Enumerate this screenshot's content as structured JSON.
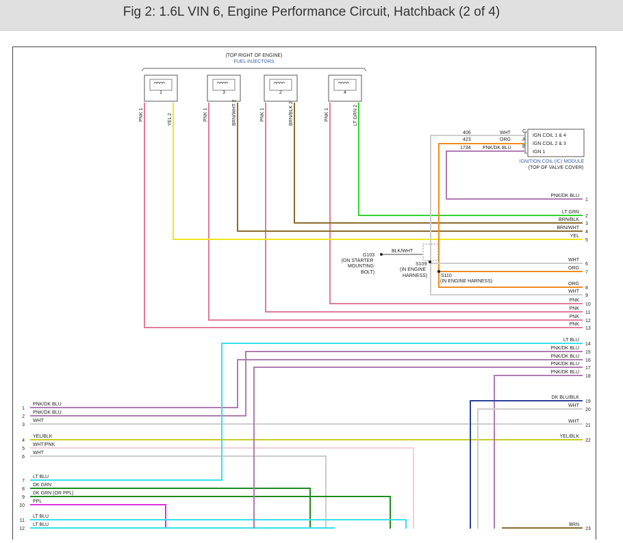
{
  "title": "Fig 2: 1.6L VIN 6, Engine Performance Circuit, Hatchback (2 of 4)",
  "injectors": {
    "location": "(TOP RIGHT OF ENGINE)",
    "name": "FUEL INJECTORS",
    "items": [
      {
        "num": "1",
        "pin1": "PNK 1",
        "pin2": "YEL 2"
      },
      {
        "num": "3",
        "pin1": "PNK 1",
        "pin2": "BRN/WHT 2"
      },
      {
        "num": "2",
        "pin1": "PNK 1",
        "pin2": "BRN/BLK 2"
      },
      {
        "num": "4",
        "pin1": "PNK 1",
        "pin2": "LT GRN 2"
      }
    ]
  },
  "ic_module": {
    "name": "IGNITION COIL (IC) MODULE",
    "location": "(TOP OF VALVE COVER)",
    "pins": [
      {
        "circuit": "406",
        "color": "WHT",
        "letter": "C",
        "label": "IGN COIL 1 & 4"
      },
      {
        "circuit": "423",
        "color": "ORG",
        "letter": "A",
        "label": "IGN COIL 2 & 3"
      },
      {
        "circuit": "1734",
        "color": "PNK/DK BLU",
        "letter": "B",
        "label": "IGN 1"
      }
    ]
  },
  "ground": {
    "id": "G103",
    "wire": "BLK/WHT",
    "location": "(ON STARTER MOUNTING BOLT)",
    "loc1": "(ON STARTER",
    "loc2": "MOUNTING",
    "loc3": "BOLT)"
  },
  "splices": [
    {
      "id": "S109",
      "loc1": "(IN ENGINE",
      "loc2": "HARNESS)"
    },
    {
      "id": "S110",
      "loc1": "(IN ENGINE HARNESS)"
    }
  ],
  "right_wires": [
    {
      "label": "PNK/DK BLU",
      "num": "1"
    },
    {
      "label": "LT GRN",
      "num": "2"
    },
    {
      "label": "BRN/BLK",
      "num": "3"
    },
    {
      "label": "BRN/WHT",
      "num": "4"
    },
    {
      "label": "YEL",
      "num": "5"
    },
    {
      "label": "WHT",
      "num": "6"
    },
    {
      "label": "ORG",
      "num": "7"
    },
    {
      "label": "ORG",
      "num": "8"
    },
    {
      "label": "WHT",
      "num": "9"
    },
    {
      "label": "PNK",
      "num": "10"
    },
    {
      "label": "PNK",
      "num": "11"
    },
    {
      "label": "PNK",
      "num": "12"
    },
    {
      "label": "PNK",
      "num": "13"
    },
    {
      "label": "LT BLU",
      "num": "14"
    },
    {
      "label": "PNK/DK BLU",
      "num": "15"
    },
    {
      "label": "PNK/DK BLU",
      "num": "16"
    },
    {
      "label": "PNK/DK BLU",
      "num": "17"
    },
    {
      "label": "PNK/DK BLU",
      "num": "18"
    },
    {
      "label": "DK BLU/BLK",
      "num": "19"
    },
    {
      "label": "WHT",
      "num": "20"
    },
    {
      "label": "WHT",
      "num": "21"
    },
    {
      "label": "YEL/BLK",
      "num": "22"
    },
    {
      "label": "BRN",
      "num": "23"
    }
  ],
  "left_wires": [
    {
      "label": "PNK/DK BLU",
      "num": "1"
    },
    {
      "label": "PNK/DK BLU",
      "num": "2"
    },
    {
      "label": "WHT",
      "num": "3"
    },
    {
      "label": "YEL/BLK",
      "num": "4"
    },
    {
      "label": "WHT/PNK",
      "num": "5"
    },
    {
      "label": "WHT",
      "num": "6"
    },
    {
      "label": "LT BLU",
      "num": "7"
    },
    {
      "label": "DK GRN",
      "num": "8"
    },
    {
      "label": "DK GRN   (OR PPL)",
      "num": "9"
    },
    {
      "label": "PPL",
      "num": "10"
    },
    {
      "label": "LT BLU",
      "num": "11"
    },
    {
      "label": "LT BLU",
      "num": "12"
    }
  ],
  "colors": {
    "pnk": "#e07b9a",
    "pnk_dk_blu": "#b07ab0",
    "yel": "#f0e41c",
    "brn": "#8a6a2c",
    "lt_grn": "#2fd52f",
    "org": "#f08a1c",
    "wht": "#cccccc",
    "lt_blu": "#35e0ec",
    "dk_grn": "#1e8a1e",
    "ppl": "#e02ee0",
    "dk_blu": "#2a3e9a",
    "yel_blk": "#c8cc22",
    "wht_pnk": "#f0d0d8"
  }
}
